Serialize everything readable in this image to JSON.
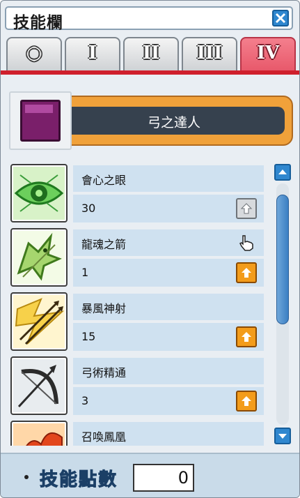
{
  "window": {
    "title": "技能欄"
  },
  "tabs": [
    {
      "label": "○"
    },
    {
      "label": "I"
    },
    {
      "label": "II"
    },
    {
      "label": "III"
    },
    {
      "label": "IV",
      "active": true
    }
  ],
  "job": {
    "name": "弓之達人"
  },
  "skills": [
    {
      "name": "會心之眼",
      "level": "30",
      "icon": "eye-icon",
      "upgrade_enabled": false
    },
    {
      "name": "龍魂之箭",
      "level": "1",
      "icon": "dragon-icon",
      "upgrade_enabled": true
    },
    {
      "name": "暴風神射",
      "level": "15",
      "icon": "storm-arrows-icon",
      "upgrade_enabled": true
    },
    {
      "name": "弓術精通",
      "level": "3",
      "icon": "bow-icon",
      "upgrade_enabled": true
    },
    {
      "name": "召喚鳳凰",
      "level": "",
      "icon": "phoenix-icon",
      "upgrade_enabled": true
    }
  ],
  "footer": {
    "skill_points_label": "技能點數",
    "skill_points_value": "0"
  },
  "colors": {
    "accent_red": "#cf1f2c",
    "tab_active": "#e8596b",
    "upgrade_orange": "#f39c1b",
    "row_bg": "#cfe1f0"
  }
}
